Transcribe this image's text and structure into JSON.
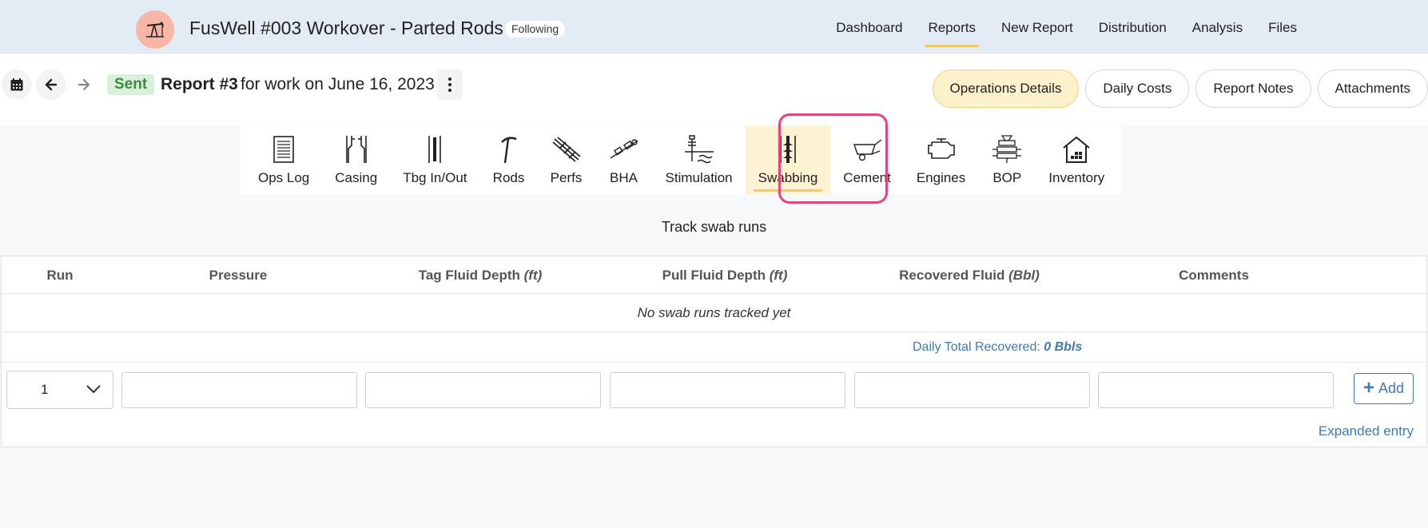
{
  "header": {
    "well_title": "FusWell #003 Workover - Parted Rods",
    "following_badge": "Following",
    "logo_icon": "pump-jack-icon",
    "nav": [
      {
        "label": "Dashboard"
      },
      {
        "label": "Reports",
        "active": true
      },
      {
        "label": "New Report"
      },
      {
        "label": "Distribution"
      },
      {
        "label": "Analysis"
      },
      {
        "label": "Files"
      }
    ]
  },
  "report_bar": {
    "status": "Sent",
    "report_number": "Report #3",
    "work_date_text": "for work on June 16, 2023",
    "pills": [
      {
        "label": "Operations Details",
        "active": true
      },
      {
        "label": "Daily Costs"
      },
      {
        "label": "Report Notes"
      },
      {
        "label": "Attachments"
      }
    ]
  },
  "tool_tabs": [
    {
      "label": "Ops Log",
      "icon": "ops-log-icon"
    },
    {
      "label": "Casing",
      "icon": "casing-icon"
    },
    {
      "label": "Tbg In/Out",
      "icon": "tubing-icon"
    },
    {
      "label": "Rods",
      "icon": "rods-icon"
    },
    {
      "label": "Perfs",
      "icon": "perfs-icon"
    },
    {
      "label": "BHA",
      "icon": "bha-icon"
    },
    {
      "label": "Stimulation",
      "icon": "stimulation-icon"
    },
    {
      "label": "Swabbing",
      "icon": "swabbing-icon",
      "active": true
    },
    {
      "label": "Cement",
      "icon": "cement-icon"
    },
    {
      "label": "Engines",
      "icon": "engine-icon"
    },
    {
      "label": "BOP",
      "icon": "bop-icon"
    },
    {
      "label": "Inventory",
      "icon": "inventory-icon"
    }
  ],
  "section_title": "Track swab runs",
  "table": {
    "columns": [
      {
        "label": "Run",
        "unit": ""
      },
      {
        "label": "Pressure",
        "unit": ""
      },
      {
        "label": "Tag Fluid Depth",
        "unit": "(ft)"
      },
      {
        "label": "Pull Fluid Depth",
        "unit": "(ft)"
      },
      {
        "label": "Recovered Fluid",
        "unit": "(Bbl)"
      },
      {
        "label": "Comments",
        "unit": ""
      }
    ],
    "empty_message": "No swab runs tracked yet",
    "daily_total_label": "Daily Total Recovered:",
    "daily_total_value": "0 Bbls",
    "entry": {
      "run_value": "1",
      "add_label": "Add"
    },
    "expanded_entry_label": "Expanded entry"
  },
  "colors": {
    "accent_yellow": "#f3c76a",
    "link_blue": "#3f7ab5",
    "highlight_pink": "#e4457a",
    "sent_green": "#3d8b45"
  }
}
